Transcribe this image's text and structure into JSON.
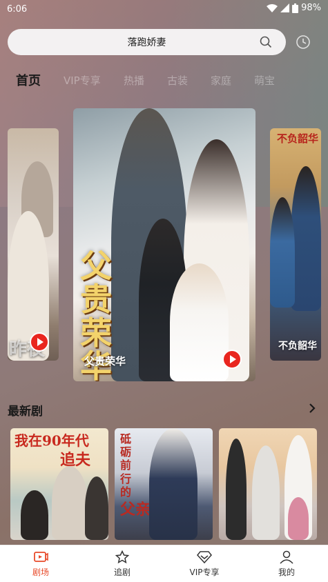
{
  "status_bar": {
    "time": "6:06",
    "battery": "98%"
  },
  "search": {
    "placeholder": "落跑娇妻"
  },
  "tabs": [
    {
      "label": "首页"
    },
    {
      "label": "VIP专享"
    },
    {
      "label": "热播"
    },
    {
      "label": "古装"
    },
    {
      "label": "家庭"
    },
    {
      "label": "萌宝"
    }
  ],
  "carousel": {
    "left_partial_title": "昨夜",
    "main_title": "父贵荣华",
    "main_poster_text": "父贵荣华",
    "right_title": "不负韶华",
    "right_poster_text": "不负韶华"
  },
  "latest": {
    "title": "最新剧",
    "cards": [
      {
        "poster_text_1": "我在90年代",
        "poster_text_2": "追夫"
      },
      {
        "poster_text_1": "砥砺前行的",
        "poster_text_2": "父亲"
      },
      {
        "poster_text_1": ""
      }
    ]
  },
  "bottom_nav": [
    {
      "label": "剧场",
      "icon": "theater-icon"
    },
    {
      "label": "追剧",
      "icon": "star-icon"
    },
    {
      "label": "VIP专享",
      "icon": "diamond-icon"
    },
    {
      "label": "我的",
      "icon": "person-icon"
    }
  ],
  "colors": {
    "accent": "#e84a2a",
    "play": "#e9261f",
    "active_tab": "#1a1a1a"
  }
}
